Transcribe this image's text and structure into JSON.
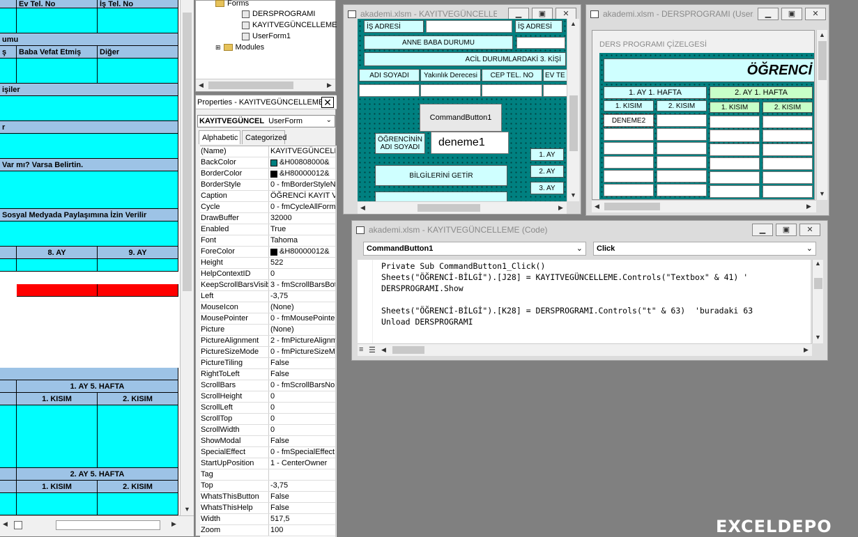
{
  "sheet": {
    "cells": {
      "ev_tel": "Ev Tel. No",
      "is_tel": "İş Tel. No",
      "umu": "umu",
      "s": "ş",
      "baba_vefat": "Baba Vefat Etmiş",
      "diger": "Diğer",
      "isiler": "işiler",
      "r": "r",
      "var_mi": "Var mı? Varsa Belirtin.",
      "sosyal": "Sosyal Medyada Paylaşımına İzin Verilir",
      "ay8": "8. AY",
      "ay9": "9. AY",
      "ay1_hafta5": "1. AY 5. HAFTA",
      "kisim1_a": "1. KISIM",
      "kisim2_a": "2. KISIM",
      "ay2_hafta5": "2. AY 5. HAFTA",
      "kisim1_b": "1. KISIM",
      "kisim2_b": "2. KISIM"
    }
  },
  "tree": {
    "forms": "Forms",
    "items": [
      "DERSPROGRAMI",
      "KAYITVEGÜNCELLEME",
      "UserForm1"
    ],
    "modules": "Modules"
  },
  "properties": {
    "title": "Properties - KAYITVEGÜNCELLEME",
    "close": "✕",
    "object_name": "KAYITVEGÜNCEL",
    "object_type": "UserForm",
    "tabs": [
      "Alphabetic",
      "Categorized"
    ],
    "rows": [
      {
        "name": "(Name)",
        "value": "KAYITVEGÜNCELLE"
      },
      {
        "name": "BackColor",
        "value": "&H00808000&",
        "swatch": "#008080"
      },
      {
        "name": "BorderColor",
        "value": "&H80000012&",
        "swatch": "#000000"
      },
      {
        "name": "BorderStyle",
        "value": "0 - fmBorderStyleN"
      },
      {
        "name": "Caption",
        "value": "ÖĞRENCİ KAYIT V"
      },
      {
        "name": "Cycle",
        "value": "0 - fmCycleAllForm"
      },
      {
        "name": "DrawBuffer",
        "value": "32000"
      },
      {
        "name": "Enabled",
        "value": "True"
      },
      {
        "name": "Font",
        "value": "Tahoma"
      },
      {
        "name": "ForeColor",
        "value": "&H80000012&",
        "swatch": "#000000"
      },
      {
        "name": "Height",
        "value": "522"
      },
      {
        "name": "HelpContextID",
        "value": "0"
      },
      {
        "name": "KeepScrollBarsVisible",
        "value": "3 - fmScrollBarsBot"
      },
      {
        "name": "Left",
        "value": "-3,75"
      },
      {
        "name": "MouseIcon",
        "value": "(None)"
      },
      {
        "name": "MousePointer",
        "value": "0 - fmMousePointer"
      },
      {
        "name": "Picture",
        "value": "(None)"
      },
      {
        "name": "PictureAlignment",
        "value": "2 - fmPictureAlignm"
      },
      {
        "name": "PictureSizeMode",
        "value": "0 - fmPictureSizeM"
      },
      {
        "name": "PictureTiling",
        "value": "False"
      },
      {
        "name": "RightToLeft",
        "value": "False"
      },
      {
        "name": "ScrollBars",
        "value": "0 - fmScrollBarsNor"
      },
      {
        "name": "ScrollHeight",
        "value": "0"
      },
      {
        "name": "ScrollLeft",
        "value": "0"
      },
      {
        "name": "ScrollTop",
        "value": "0"
      },
      {
        "name": "ScrollWidth",
        "value": "0"
      },
      {
        "name": "ShowModal",
        "value": "False"
      },
      {
        "name": "SpecialEffect",
        "value": "0 - fmSpecialEffect"
      },
      {
        "name": "StartUpPosition",
        "value": "1 - CenterOwner"
      },
      {
        "name": "Tag",
        "value": ""
      },
      {
        "name": "Top",
        "value": "-3,75"
      },
      {
        "name": "WhatsThisButton",
        "value": "False"
      },
      {
        "name": "WhatsThisHelp",
        "value": "False"
      },
      {
        "name": "Width",
        "value": "517,5"
      },
      {
        "name": "Zoom",
        "value": "100"
      }
    ]
  },
  "win_kayit": {
    "title": "akademi.xlsm - KAYITVEGÜNCELLEME",
    "labels": {
      "is_adresi_1": "İŞ ADRESİ",
      "is_adresi_2": "İŞ ADRESİ",
      "anne_baba": "ANNE BABA DURUMU",
      "acil": "ACİL DURUMLARDAKİ 3. KİŞİ",
      "adi_soyadi": "ADI SOYADI",
      "yakinlik": "Yakınlık Derecesi",
      "cep_tel": "CEP TEL. NO",
      "ev_tel": "EV TE",
      "commandbutton": "CommandButton1",
      "ogrenci_adi": "ÖĞRENCİNİN ADI SOYADI",
      "deneme1": "deneme1",
      "ay1": "1. AY",
      "ay2": "2. AY",
      "ay3": "3. AY",
      "bilgileri": "BİLGİLERİNİ GETİR"
    }
  },
  "win_ders": {
    "title": "akademi.xlsm - DERSPROGRAMI (User...",
    "caption": "DERS PROGRAMI ÇİZELGESİ",
    "big_title": "ÖĞRENCİ",
    "hafta1": "1. AY 1. HAFTA",
    "hafta2": "2. AY 1. HAFTA",
    "k1a": "1. KISIM",
    "k2a": "2. KISIM",
    "k1b": "1. KISIM",
    "k2b": "2. KISIM",
    "deneme2": "DENEME2"
  },
  "win_code": {
    "title": "akademi.xlsm - KAYITVEGÜNCELLEME (Code)",
    "object": "CommandButton1",
    "procedure": "Click",
    "lines": [
      "Private Sub CommandButton1_Click()",
      "Sheets(\"ÖĞRENCİ-BİLGİ\").[J28] = KAYITVEGÜNCELLEME.Controls(\"Textbox\" & 41) '",
      "DERSPROGRAMI.Show",
      "",
      "Sheets(\"ÖĞRENCİ-BİLGİ\").[K28] = DERSPROGRAMI.Controls(\"t\" & 63)  'buradaki 63",
      "Unload DERSPROGRAMI"
    ]
  },
  "watermark": "EXCELDEPO"
}
